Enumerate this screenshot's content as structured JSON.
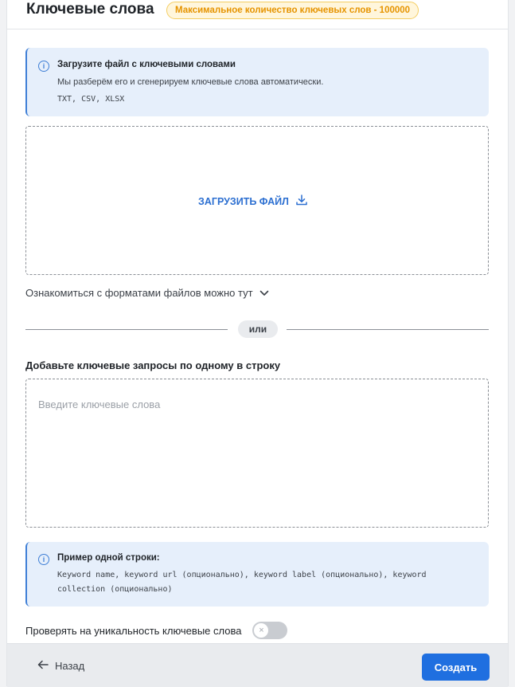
{
  "header": {
    "title": "Ключевые слова",
    "limit_badge": "Максимальное количество ключевых слов - 100000"
  },
  "upload_info": {
    "icon": "info-icon",
    "title": "Загрузите файл с ключевыми словами",
    "text": "Мы разберём его и сгенерируем ключевые слова автоматически.",
    "formats": "TXT, CSV, XLSX"
  },
  "dropzone": {
    "upload_label": "ЗАГРУЗИТЬ ФАЙЛ",
    "upload_icon": "download-icon"
  },
  "formats_link": {
    "label": "Ознакомиться с форматами файлов можно тут",
    "icon": "chevron-down-icon"
  },
  "divider": {
    "label": "или"
  },
  "keywords_input": {
    "label": "Добавьте ключевые запросы по одному в строку",
    "placeholder": "Введите ключевые слова",
    "value": ""
  },
  "example_info": {
    "icon": "info-icon",
    "title": "Пример одной строки:",
    "line1": "Keyword name, keyword url (опционально), keyword label (опционально), keyword",
    "line2": "collection (опционально)"
  },
  "uniqueness": {
    "label": "Проверять на уникальность ключевые слова",
    "enabled": false,
    "knob_glyph": "×"
  },
  "footer": {
    "back_label": "Назад",
    "back_icon": "arrow-left-icon",
    "create_label": "Создать"
  },
  "colors": {
    "accent": "#1f6fe0",
    "info_bg": "#e6effb",
    "badge_text": "#e69400",
    "badge_bg": "#fff6dc"
  }
}
